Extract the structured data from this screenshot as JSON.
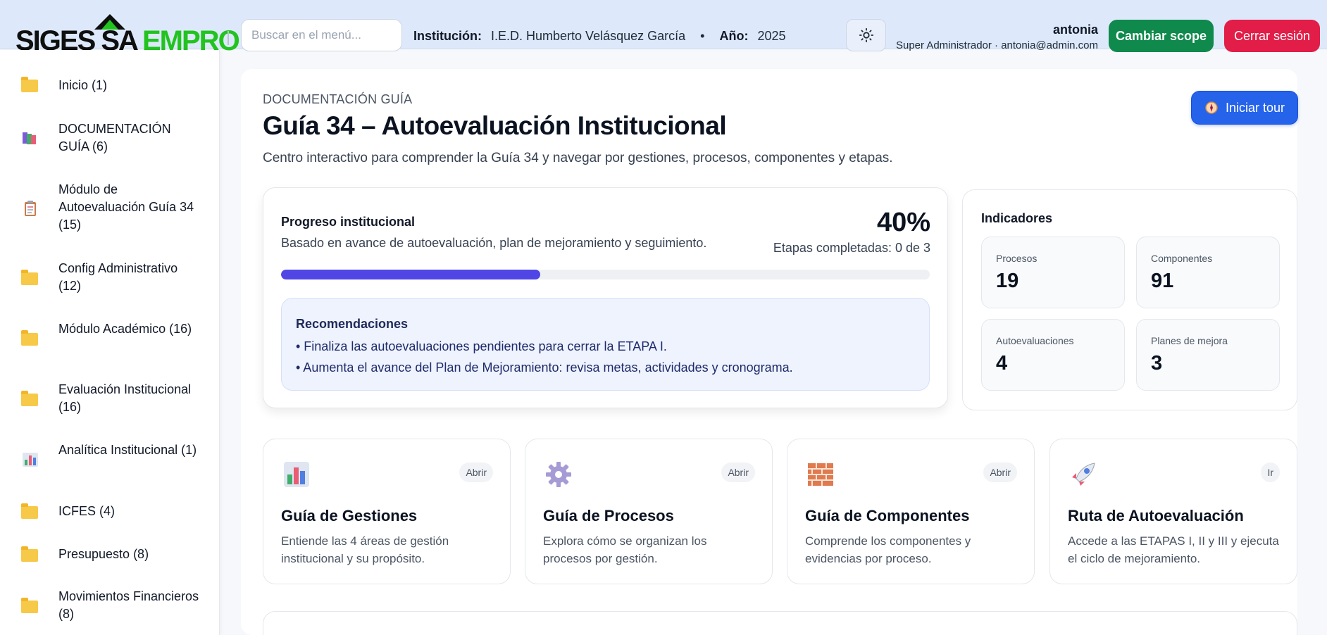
{
  "topbar": {
    "logo_part1": "SIGES SA",
    "logo_part2": "EMPRO",
    "search_placeholder": "Buscar en el menú...",
    "institution_label": "Institución:",
    "institution_value": "I.E.D. Humberto Velásquez García",
    "separator": "•",
    "year_label": "Año:",
    "year_value": "2025",
    "theme_icon": "sun-icon",
    "user_name": "antonia",
    "user_role": "Super Administrador · antonia@admin.com",
    "scope_button": "Cambiar scope",
    "logout_button": "Cerrar sesión"
  },
  "sidebar": {
    "items": [
      {
        "label": "Inicio (1)",
        "icon": "folder-icon"
      },
      {
        "label": "DOCUMENTACIÓN GUÍA (6)",
        "icon": "books-icon"
      },
      {
        "label": "Módulo de Autoevaluación Guía 34 (15)",
        "icon": "clipboard-icon"
      },
      {
        "label": "Config Administrativo (12)",
        "icon": "folder-icon"
      },
      {
        "label": "Módulo Académico (16)",
        "icon": "folder-icon"
      },
      {
        "label": "Evaluación Institucional (16)",
        "icon": "folder-icon"
      },
      {
        "label": "Analítica Institucional (1)",
        "icon": "bar-chart-icon"
      },
      {
        "label": "ICFES (4)",
        "icon": "folder-icon"
      },
      {
        "label": "Presupuesto (8)",
        "icon": "folder-icon"
      },
      {
        "label": "Movimientos Financieros (8)",
        "icon": "folder-icon"
      }
    ]
  },
  "header": {
    "breadcrumb": "DOCUMENTACIÓN GUÍA",
    "title": "Guía 34 – Autoevaluación Institucional",
    "subtitle": "Centro interactivo para comprender la Guía 34 y navegar por gestiones, procesos, componentes y etapas.",
    "tour_button": "Iniciar tour",
    "tour_icon": "compass-icon"
  },
  "progress": {
    "title": "Progreso institucional",
    "subtitle": "Basado en avance de autoevaluación, plan de mejoramiento y seguimiento.",
    "percent_label": "40%",
    "percent": 40,
    "steps_label": "Etapas completadas: 0 de 3",
    "bar_color": "#4f46e5",
    "recommendations_title": "Recomendaciones",
    "recommendations": [
      "• Finaliza las autoevaluaciones pendientes para cerrar la ETAPA I.",
      "• Aumenta el avance del Plan de Mejoramiento: revisa metas, actividades y cronograma."
    ]
  },
  "indicators": {
    "title": "Indicadores",
    "items": [
      {
        "label": "Procesos",
        "value": "19"
      },
      {
        "label": "Componentes",
        "value": "91"
      },
      {
        "label": "Autoevaluaciones",
        "value": "4"
      },
      {
        "label": "Planes de mejora",
        "value": "3"
      }
    ]
  },
  "guides": [
    {
      "title": "Guía de Gestiones",
      "desc": "Entiende las 4 áreas de gestión institucional y su propósito.",
      "badge": "Abrir",
      "icon": "bar-chart-icon"
    },
    {
      "title": "Guía de Procesos",
      "desc": "Explora cómo se organizan los procesos por gestión.",
      "badge": "Abrir",
      "icon": "gear-icon"
    },
    {
      "title": "Guía de Componentes",
      "desc": "Comprende los componentes y evidencias por proceso.",
      "badge": "Abrir",
      "icon": "bricks-icon"
    },
    {
      "title": "Ruta de Autoevaluación",
      "desc": "Accede a las ETAPAS I, II y III y ejecuta el ciclo de mejoramiento.",
      "badge": "Ir",
      "icon": "rocket-icon"
    }
  ],
  "colors": {
    "accent": "#2563eb",
    "scope_button": "#0f8a4c",
    "logout_button": "#e11d48",
    "logo_green": "#22c31f"
  }
}
